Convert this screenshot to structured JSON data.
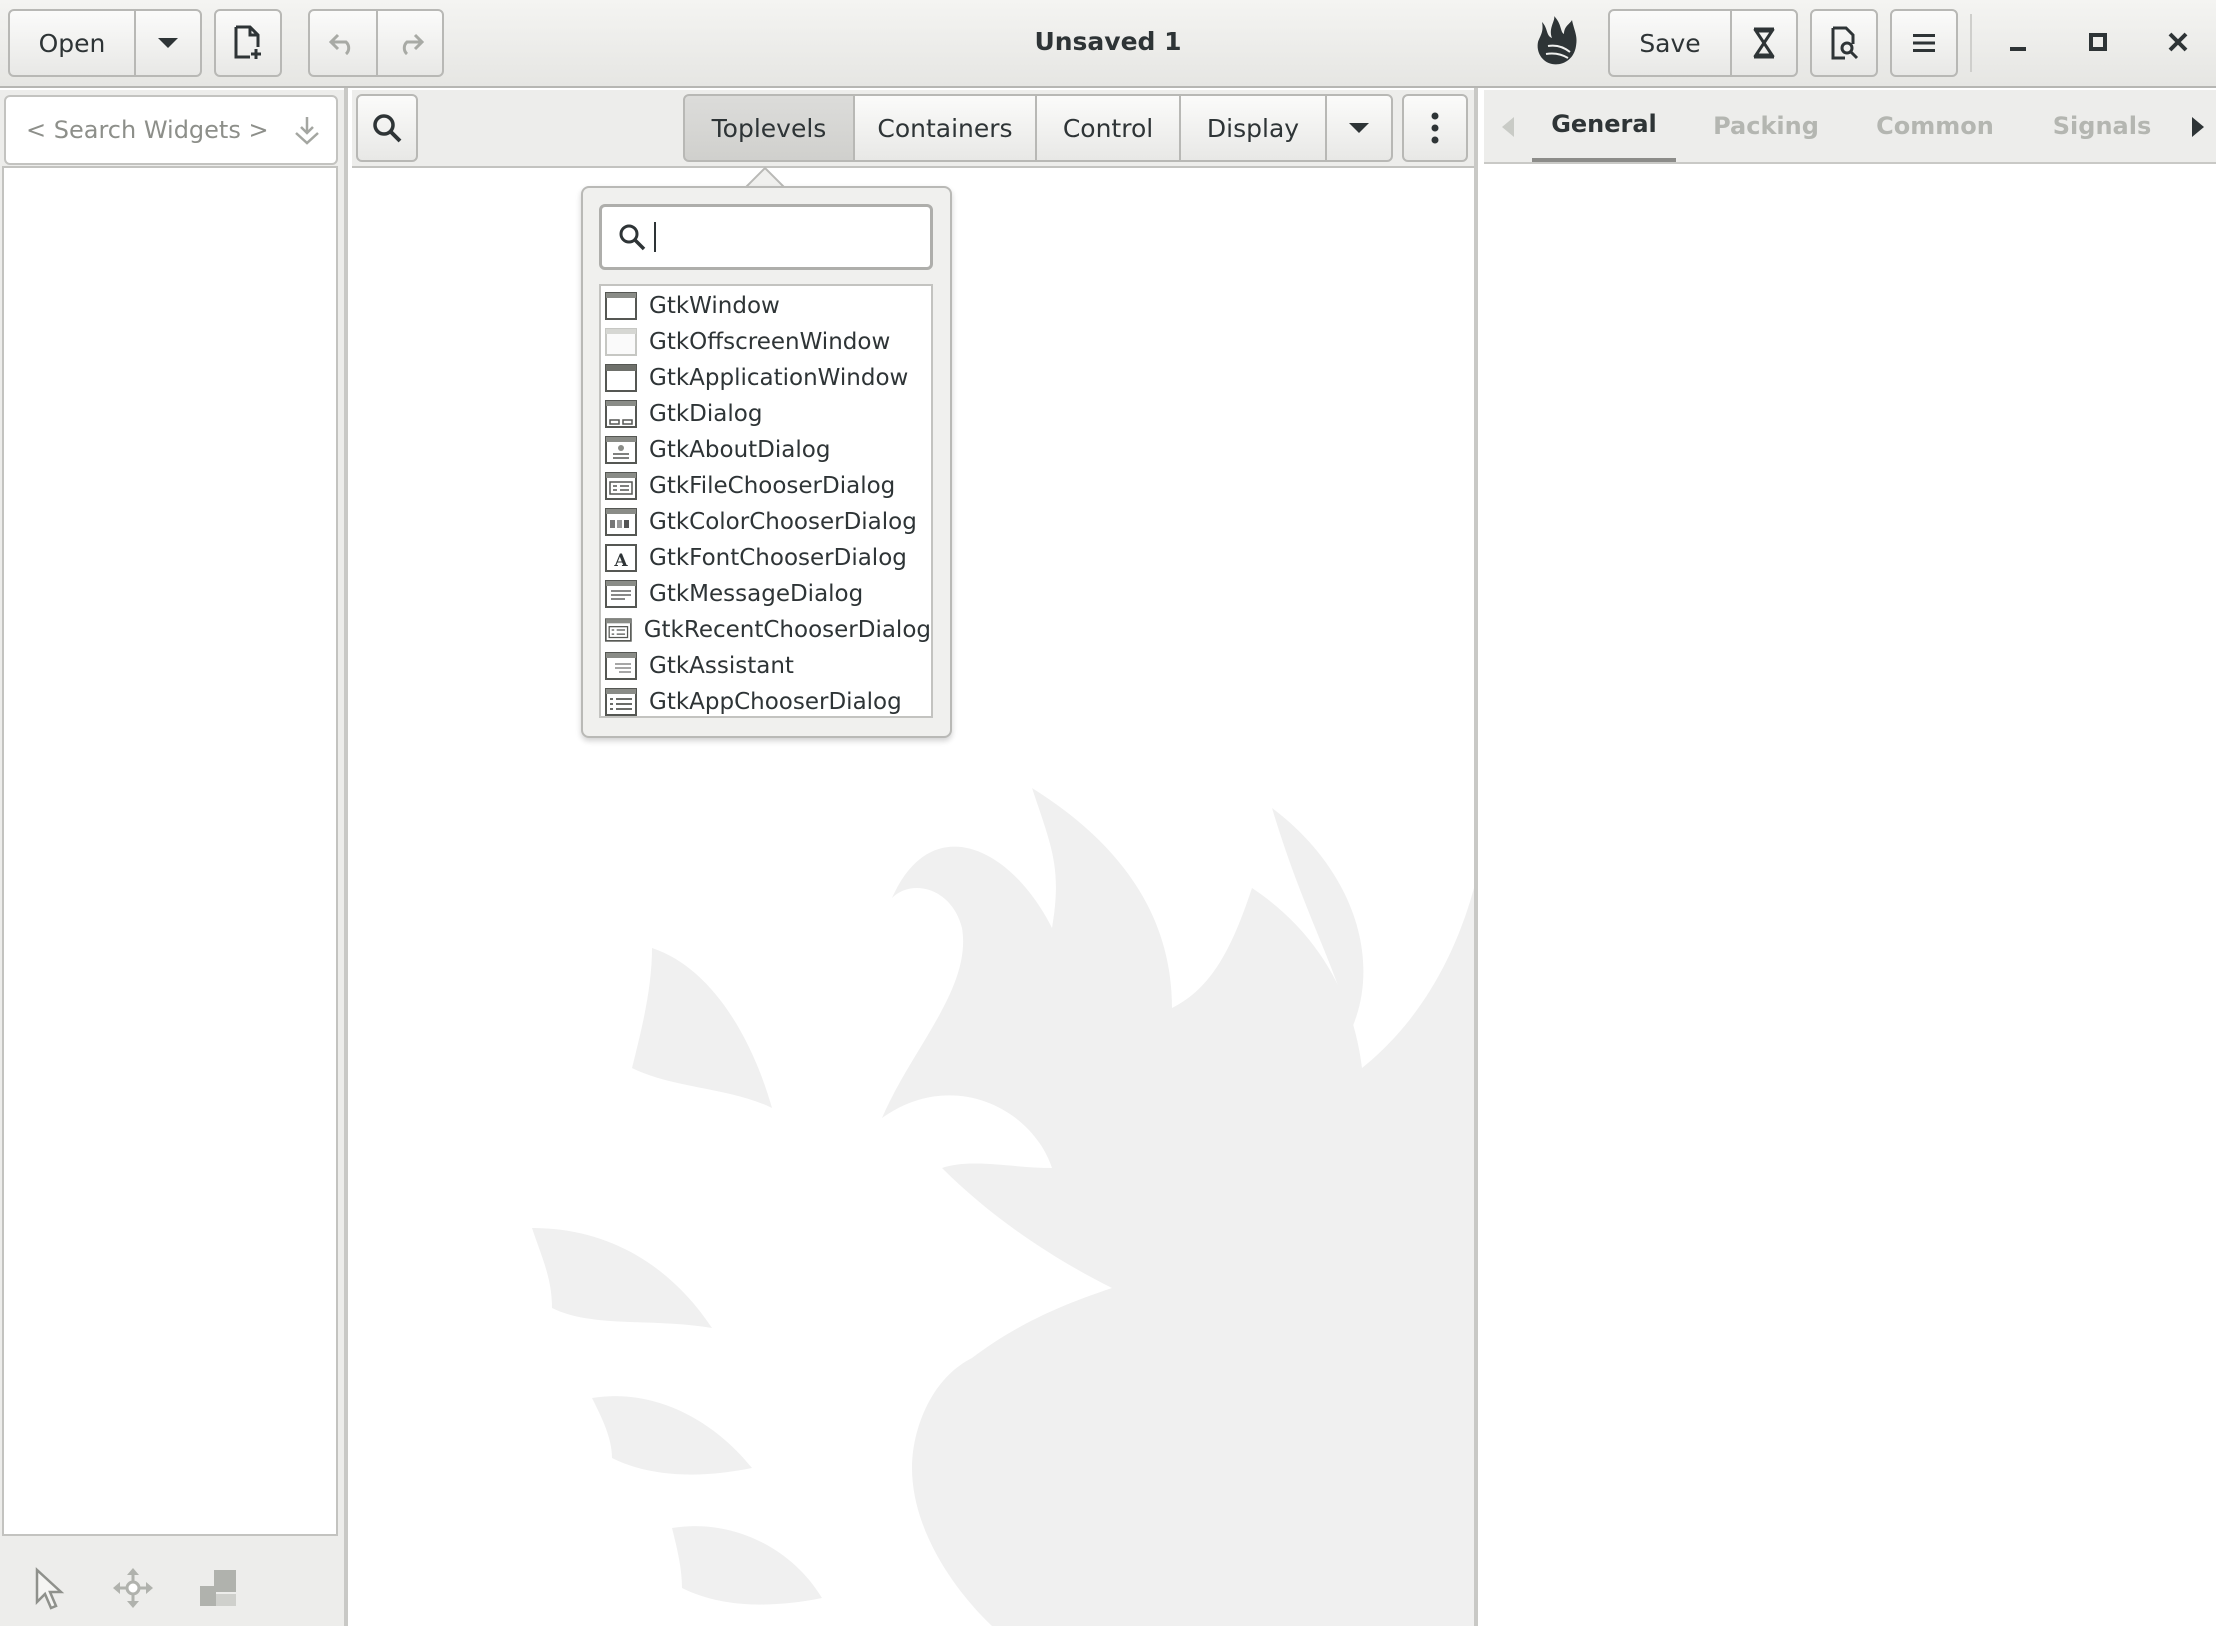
{
  "header": {
    "open_label": "Open",
    "title": "Unsaved 1",
    "save_label": "Save",
    "icons": [
      "chevron-down-icon",
      "new-document-icon",
      "undo-icon",
      "redo-icon",
      "glade-logo-icon",
      "export-icon",
      "preview-icon",
      "hamburger-menu-icon",
      "minimize-icon",
      "maximize-icon",
      "close-icon"
    ]
  },
  "left_panel": {
    "search_placeholder": "< Search Widgets >",
    "modes": [
      "pointer-mode-icon",
      "drag-resize-mode-icon",
      "margin-edit-mode-icon"
    ]
  },
  "palette": {
    "tabs": [
      "Toplevels",
      "Containers",
      "Control",
      "Display"
    ],
    "active_tab": "Toplevels"
  },
  "popover": {
    "search_value": "",
    "items": [
      {
        "label": "GtkWindow",
        "icon": "window-icon"
      },
      {
        "label": "GtkOffscreenWindow",
        "icon": "offscreen-window-icon"
      },
      {
        "label": "GtkApplicationWindow",
        "icon": "application-window-icon"
      },
      {
        "label": "GtkDialog",
        "icon": "dialog-icon"
      },
      {
        "label": "GtkAboutDialog",
        "icon": "about-dialog-icon"
      },
      {
        "label": "GtkFileChooserDialog",
        "icon": "file-chooser-dialog-icon"
      },
      {
        "label": "GtkColorChooserDialog",
        "icon": "color-chooser-dialog-icon"
      },
      {
        "label": "GtkFontChooserDialog",
        "icon": "font-chooser-dialog-icon"
      },
      {
        "label": "GtkMessageDialog",
        "icon": "message-dialog-icon"
      },
      {
        "label": "GtkRecentChooserDialog",
        "icon": "recent-chooser-dialog-icon"
      },
      {
        "label": "GtkAssistant",
        "icon": "assistant-icon"
      },
      {
        "label": "GtkAppChooserDialog",
        "icon": "app-chooser-dialog-icon"
      }
    ]
  },
  "editor": {
    "tabs": [
      "General",
      "Packing",
      "Common",
      "Signals"
    ],
    "active_tab": "General"
  },
  "colors": {
    "header_bg": "#ececea",
    "border": "#b8b8b5",
    "text": "#2e3436",
    "inactive_tab": "#b4b6b1",
    "watermark": "#f0f0f0"
  }
}
